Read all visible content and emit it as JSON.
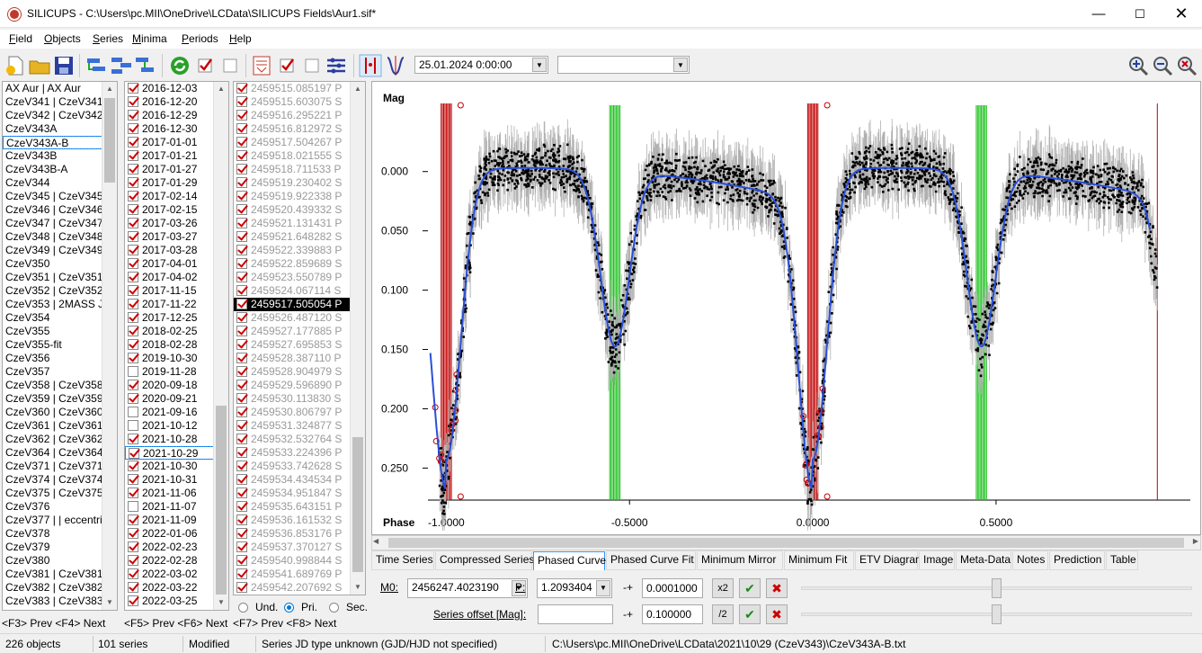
{
  "window": {
    "title": "SILICUPS - C:\\Users\\pc.MII\\OneDrive\\LCData\\SILICUPS Fields\\Aur1.sif*"
  },
  "menu": [
    "Field",
    "Objects",
    "Series",
    "Minima",
    "Periods",
    "Help"
  ],
  "toolbar": {
    "date_value": "25.01.2024   0:00:00",
    "second_combo": ""
  },
  "objects": [
    "AX Aur | AX Aur",
    "CzeV341 | CzeV341",
    "CzeV342 | CzeV342",
    "CzeV343A",
    "CzeV343A-B",
    "CzeV343B",
    "CzeV343B-A",
    "CzeV344",
    "CzeV345 | CzeV345",
    "CzeV346 | CzeV346 |",
    "CzeV347 | CzeV347",
    "CzeV348 | CzeV348",
    "CzeV349 | CzeV349",
    "CzeV350",
    "CzeV351 | CzeV351",
    "CzeV352 | CzeV352",
    "CzeV353 | 2MASS J0!",
    "CzeV354",
    "CzeV355",
    "CzeV355-fit",
    "CzeV356",
    "CzeV357",
    "CzeV358 | CzeV358",
    "CzeV359 | CzeV359",
    "CzeV360 | CzeV360",
    "CzeV361 | CzeV361",
    "CzeV362 | CzeV362",
    "CzeV364 | CzeV364 |",
    "CzeV371 | CzeV371",
    "CzeV374 | CzeV374",
    "CzeV375 | CzeV375",
    "CzeV376",
    "CzeV377 | | eccentric",
    "CzeV378",
    "CzeV379",
    "CzeV380",
    "CzeV381 | CzeV381",
    "CzeV382 | CzeV382",
    "CzeV383 | CzeV383"
  ],
  "objects_selected": 4,
  "series": [
    {
      "label": "2016-12-03",
      "checked": true
    },
    {
      "label": "2016-12-20",
      "checked": true
    },
    {
      "label": "2016-12-29",
      "checked": true
    },
    {
      "label": "2016-12-30",
      "checked": true
    },
    {
      "label": "2017-01-01",
      "checked": true
    },
    {
      "label": "2017-01-21",
      "checked": true
    },
    {
      "label": "2017-01-27",
      "checked": true
    },
    {
      "label": "2017-01-29",
      "checked": true
    },
    {
      "label": "2017-02-14",
      "checked": true
    },
    {
      "label": "2017-02-15",
      "checked": true
    },
    {
      "label": "2017-03-26",
      "checked": true
    },
    {
      "label": "2017-03-27",
      "checked": true
    },
    {
      "label": "2017-03-28",
      "checked": true
    },
    {
      "label": "2017-04-01",
      "checked": true
    },
    {
      "label": "2017-04-02",
      "checked": true
    },
    {
      "label": "2017-11-15",
      "checked": true
    },
    {
      "label": "2017-11-22",
      "checked": true
    },
    {
      "label": "2017-12-25",
      "checked": true
    },
    {
      "label": "2018-02-25",
      "checked": true
    },
    {
      "label": "2018-02-28",
      "checked": true
    },
    {
      "label": "2019-10-30",
      "checked": true
    },
    {
      "label": "2019-11-28",
      "checked": false
    },
    {
      "label": "2020-09-18",
      "checked": true
    },
    {
      "label": "2020-09-21",
      "checked": true
    },
    {
      "label": "2021-09-16",
      "checked": false
    },
    {
      "label": "2021-10-12",
      "checked": false
    },
    {
      "label": "2021-10-28",
      "checked": true
    },
    {
      "label": "2021-10-29",
      "checked": true
    },
    {
      "label": "2021-10-30",
      "checked": true
    },
    {
      "label": "2021-10-31",
      "checked": true
    },
    {
      "label": "2021-11-06",
      "checked": true
    },
    {
      "label": "2021-11-07",
      "checked": false
    },
    {
      "label": "2021-11-09",
      "checked": true
    },
    {
      "label": "2022-01-06",
      "checked": true
    },
    {
      "label": "2022-02-23",
      "checked": true
    },
    {
      "label": "2022-02-28",
      "checked": true
    },
    {
      "label": "2022-03-02",
      "checked": true
    },
    {
      "label": "2022-03-22",
      "checked": true
    },
    {
      "label": "2022-03-25",
      "checked": true
    }
  ],
  "series_selected": 27,
  "minima": [
    "2459515.085197 P",
    "2459515.603075 S",
    "2459516.295221 P",
    "2459516.812972 S",
    "2459517.504267 P",
    "2459518.021555 S",
    "2459518.711533 P",
    "2459519.230402 S",
    "2459519.922338 P",
    "2459520.439332 S",
    "2459521.131431 P",
    "2459521.648282 S",
    "2459522.339883 P",
    "2459522.859689 S",
    "2459523.550789 P",
    "2459524.067114 S",
    "2459517.505054 P",
    "2459526.487120 S",
    "2459527.177885 P",
    "2459527.695853 S",
    "2459528.387110 P",
    "2459528.904979 S",
    "2459529.596890 P",
    "2459530.113830 S",
    "2459530.806797 P",
    "2459531.324877 S",
    "2459532.532764 S",
    "2459533.224396 P",
    "2459533.742628 S",
    "2459534.434534 P",
    "2459534.951847 S",
    "2459535.643151 P",
    "2459536.161532 S",
    "2459536.853176 P",
    "2459537.370127 S",
    "2459540.998844 S",
    "2459541.689769 P",
    "2459542.207692 S"
  ],
  "minima_highlight": 16,
  "footers": {
    "objects": "<F3> Prev <F4> Next",
    "series": "<F5> Prev <F6> Next",
    "minima": "<F7> Prev <F8> Next"
  },
  "min_type": {
    "und": "Und.",
    "pri": "Pri.",
    "sec": "Sec."
  },
  "status": {
    "objects": "226 objects",
    "series": "101 series",
    "modified": "Modified",
    "jd": "Series JD type unknown (GJD/HJD not specified)",
    "path": "C:\\Users\\pc.MII\\OneDrive\\LCData\\2021\\10\\29 (CzeV343)\\CzeV343A-B.txt"
  },
  "tabs": [
    "Time Series",
    "Compressed Series",
    "Phased Curve",
    "Phased Curve Fit",
    "Minimum Mirror",
    "Minimum Fit",
    "ETV Diagram",
    "Image",
    "Meta-Data",
    "Notes",
    "Prediction",
    "Table"
  ],
  "active_tab": 2,
  "panel": {
    "m0_label": "M0:",
    "m0_value": "2456247.4023190",
    "p_label": "P:",
    "p_value": "1.2093404",
    "pm1": "-+",
    "p_step": "0.0001000",
    "x2": "x2",
    "offset_label": "Series offset [Mag]:",
    "offset_value": "",
    "pm2": "-+",
    "offset_step": "0.100000",
    "div2": "/2"
  },
  "chart_data": {
    "type": "scatter",
    "ylabel": "Mag",
    "xlabel": "Phase",
    "x_ticks": [
      "-1.0000",
      "-0.5000",
      "0.0000",
      "0.5000"
    ],
    "x_tick_values": [
      -1.0,
      -0.5,
      0.0,
      0.5
    ],
    "y_ticks": [
      "0.000",
      "0.050",
      "0.100",
      "0.150",
      "0.200",
      "0.250"
    ],
    "y_tick_values": [
      0.0,
      0.05,
      0.1,
      0.15,
      0.2,
      0.25
    ],
    "xlim": [
      -1.05,
      1.03
    ],
    "ylim": [
      -0.065,
      0.277
    ],
    "y_inverted": true,
    "primary_depth": 0.24,
    "secondary_depth": 0.145,
    "max_level": -0.003,
    "primary_minima_phases": [
      -1.0,
      0.0
    ],
    "secondary_minima_phases": [
      -0.54,
      0.46
    ],
    "colors": {
      "points": "#000000",
      "errorbars": "#b0b0b0",
      "model": "#2a4fd8",
      "primary": "#c00000",
      "secondary": "#1ec21e"
    }
  }
}
